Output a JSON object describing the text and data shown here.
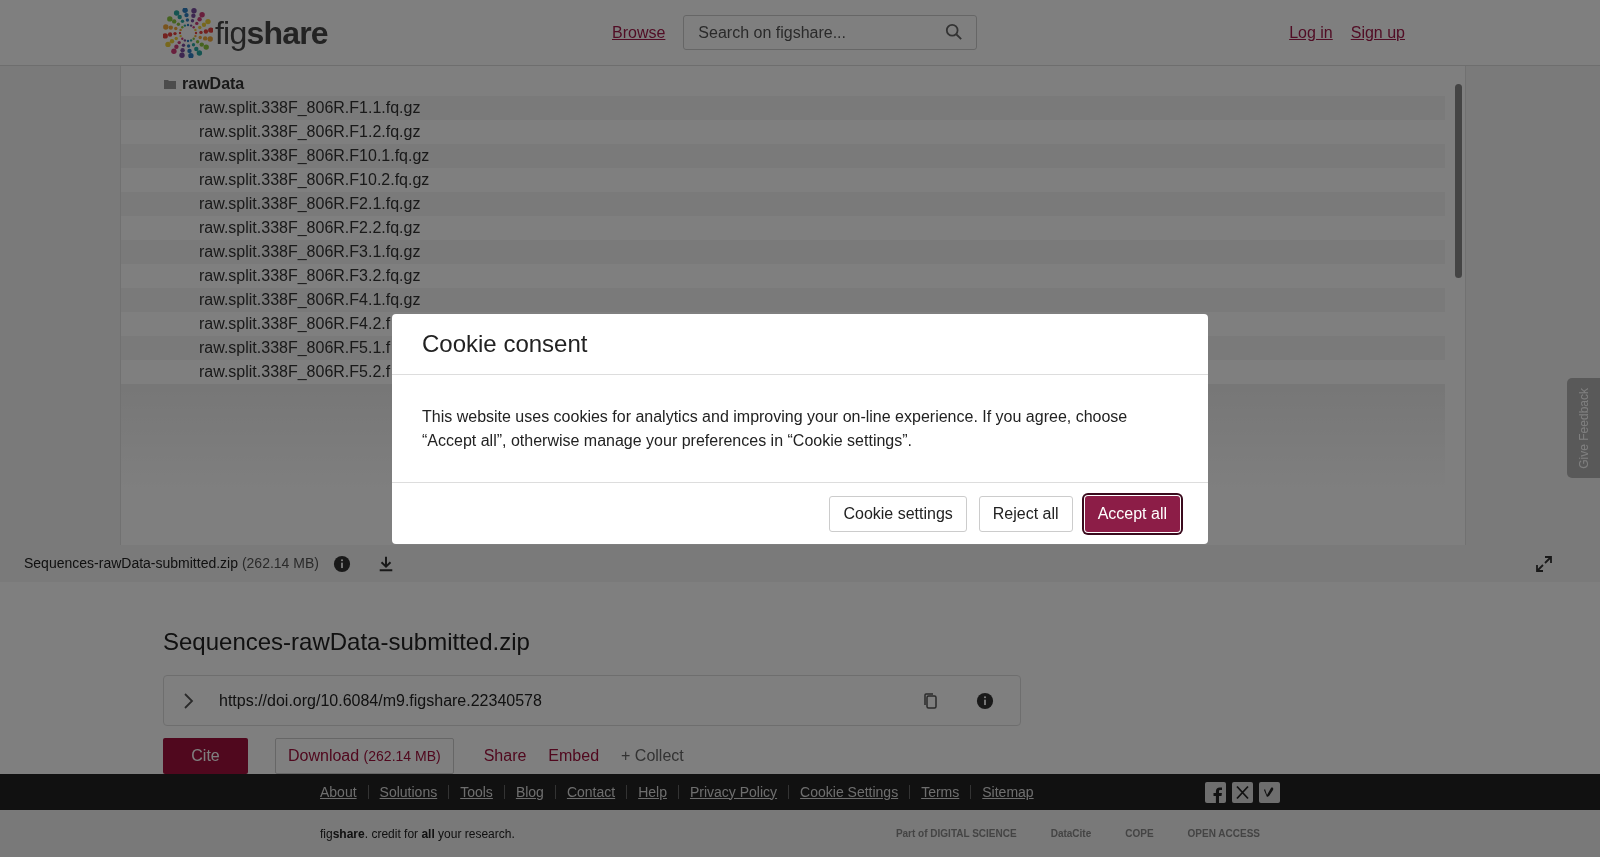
{
  "header": {
    "logo": "fig**share**",
    "nav_link": "Browse",
    "search": {
      "placeholder": "Search on figshare..."
    },
    "auth_links": [
      "Log in",
      "Sign up"
    ]
  },
  "file_tree": {
    "name": "rawData",
    "children": [
      {
        "name": "raw.split.338F_806R.F1.1.fq.gz"
      },
      {
        "name": "raw.split.338F_806R.F1.2.fq.gz"
      },
      {
        "name": "raw.split.338F_806R.F10.1.fq.gz"
      },
      {
        "name": "raw.split.338F_806R.F10.2.fq.gz"
      },
      {
        "name": "raw.split.338F_806R.F2.1.fq.gz"
      },
      {
        "name": "raw.split.338F_806R.F2.2.fq.gz"
      },
      {
        "name": "raw.split.338F_806R.F3.1.fq.gz"
      },
      {
        "name": "raw.split.338F_806R.F3.2.fq.gz"
      },
      {
        "name": "raw.split.338F_806R.F4.1.fq.gz"
      },
      {
        "name": "raw.split.338F_806R.F4.2.f"
      },
      {
        "name": "raw.split.338F_806R.F5.1.f"
      },
      {
        "name": "raw.split.338F_806R.F5.2.f"
      }
    ]
  },
  "viewer_bar": {
    "filename": "Sequences-rawData-submitted.zip",
    "size": "(262.14 MB)"
  },
  "item": {
    "title": "Sequences-rawData-submitted.zip",
    "doi": "https://doi.org/10.6084/m9.figshare.22340578",
    "actions": [
      {
        "label": "Cite",
        "kind": "primary"
      },
      {
        "label": "Download",
        "note": "(262.14 MB)",
        "kind": "outline"
      },
      {
        "label": "Share",
        "kind": "link"
      },
      {
        "label": "Embed",
        "kind": "link"
      },
      {
        "label": "+ Collect",
        "kind": "muted"
      }
    ]
  },
  "footer": {
    "links": [
      "About",
      "Solutions",
      "Tools",
      "Blog",
      "Contact",
      "Help",
      "Privacy Policy",
      "Cookie Settings",
      "Terms",
      "Sitemap"
    ],
    "tagline": "fig**share**. credit for **all** your research.",
    "partners": [
      "Part of DIGITAL SCIENCE",
      "DataCite",
      "COPE",
      "OPEN ACCESS"
    ]
  },
  "feedback_tab": "Give Feedback",
  "cookie_modal": {
    "title": "Cookie consent",
    "body": "This website uses cookies for analytics and improving your on-line experience. If you agree, choose “Accept all”, otherwise manage your preferences in “Cookie settings”.",
    "buttons": [
      {
        "label": "Cookie settings",
        "kind": "secondary",
        "focused": false
      },
      {
        "label": "Reject all",
        "kind": "secondary",
        "focused": false
      },
      {
        "label": "Accept all",
        "kind": "primary",
        "focused": true
      }
    ]
  }
}
